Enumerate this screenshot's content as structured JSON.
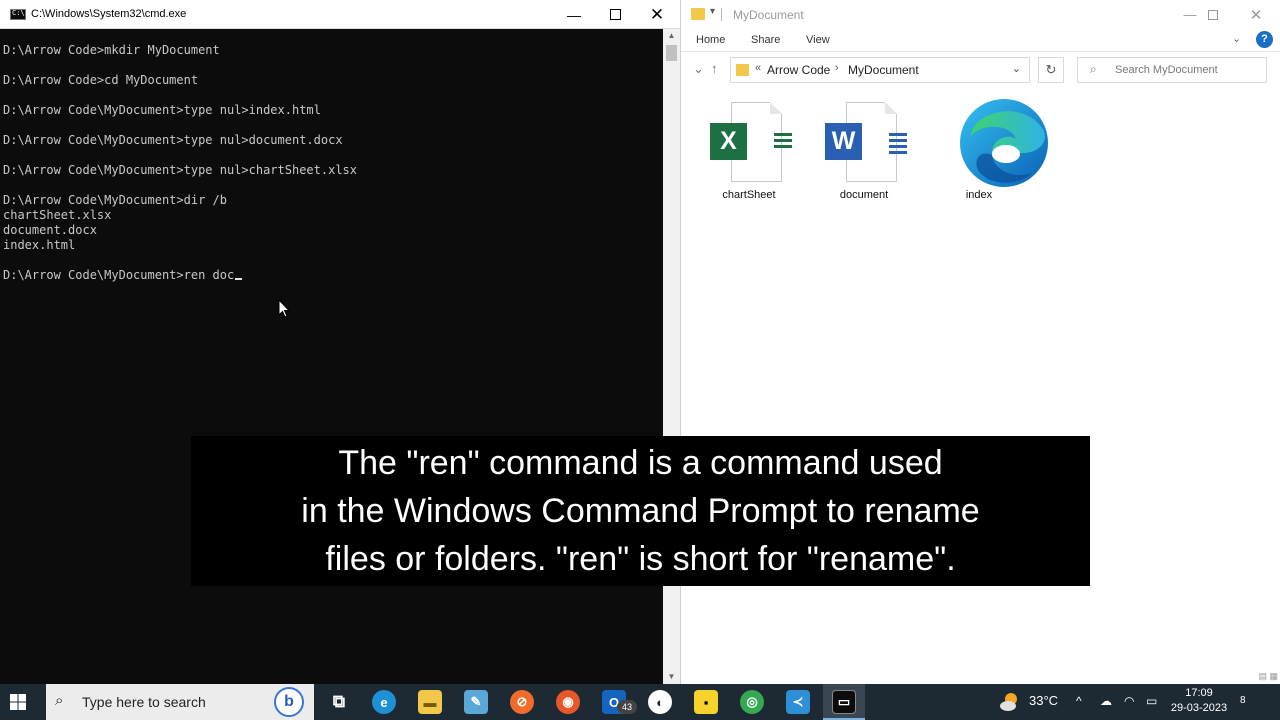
{
  "cmd": {
    "title": "C:\\Windows\\System32\\cmd.exe",
    "icon_text": "C:\\",
    "lines": [
      "D:\\Arrow Code>mkdir MyDocument",
      "",
      "D:\\Arrow Code>cd MyDocument",
      "",
      "D:\\Arrow Code\\MyDocument>type nul>index.html",
      "",
      "D:\\Arrow Code\\MyDocument>type nul>document.docx",
      "",
      "D:\\Arrow Code\\MyDocument>type nul>chartSheet.xlsx",
      "",
      "D:\\Arrow Code\\MyDocument>dir /b",
      "chartSheet.xlsx",
      "document.docx",
      "index.html",
      "",
      "D:\\Arrow Code\\MyDocument>ren doc"
    ]
  },
  "explorer": {
    "title": "MyDocument",
    "ribbon_tabs": [
      "Home",
      "Share",
      "View"
    ],
    "breadcrumb": [
      "Arrow Code",
      "MyDocument"
    ],
    "breadcrumb_prefix": "«",
    "search_placeholder": "Search MyDocument",
    "files": [
      {
        "name": "chartSheet",
        "kind": "excel",
        "letter": "X",
        "color": "#1d7044"
      },
      {
        "name": "document",
        "kind": "word",
        "letter": "W",
        "color": "#2b5fb4"
      },
      {
        "name": "index",
        "kind": "edge",
        "letter": "",
        "color": "#1f8fd6"
      }
    ]
  },
  "caption": {
    "lines": [
      "The \"ren\" command is a command used",
      "in the Windows Command Prompt to rename",
      "files or folders. \"ren\" is short for \"rename\"."
    ]
  },
  "taskbar": {
    "search_placeholder": "Type here to search",
    "bing_label": "b",
    "apps": [
      {
        "name": "task-view",
        "color": "#1e2a33",
        "glyph": "⧉"
      },
      {
        "name": "edge",
        "color": "#1f8fd6",
        "glyph": "e"
      },
      {
        "name": "file-explorer",
        "color": "#f3c84a",
        "glyph": "▬"
      },
      {
        "name": "notepad",
        "color": "#5aa7d8",
        "glyph": "✎"
      },
      {
        "name": "postman",
        "color": "#ef6c2a",
        "glyph": "⊘"
      },
      {
        "name": "firefox",
        "color": "#e8572a",
        "glyph": "◉"
      },
      {
        "name": "outlook",
        "color": "#1565c0",
        "glyph": "O"
      },
      {
        "name": "circle-app",
        "color": "#ffffff",
        "glyph": "◐"
      },
      {
        "name": "sticky-notes",
        "color": "#f7d12c",
        "glyph": "▪"
      },
      {
        "name": "chrome",
        "color": "#34a853",
        "glyph": "◎"
      },
      {
        "name": "vscode",
        "color": "#2d8fd5",
        "glyph": "≺"
      },
      {
        "name": "cmd",
        "color": "#0c0c0c",
        "glyph": "▭"
      }
    ],
    "outlook_badge": "43",
    "temperature": "33°C",
    "time": "17:09",
    "date": "29-03-2023",
    "notification_count": "8"
  }
}
